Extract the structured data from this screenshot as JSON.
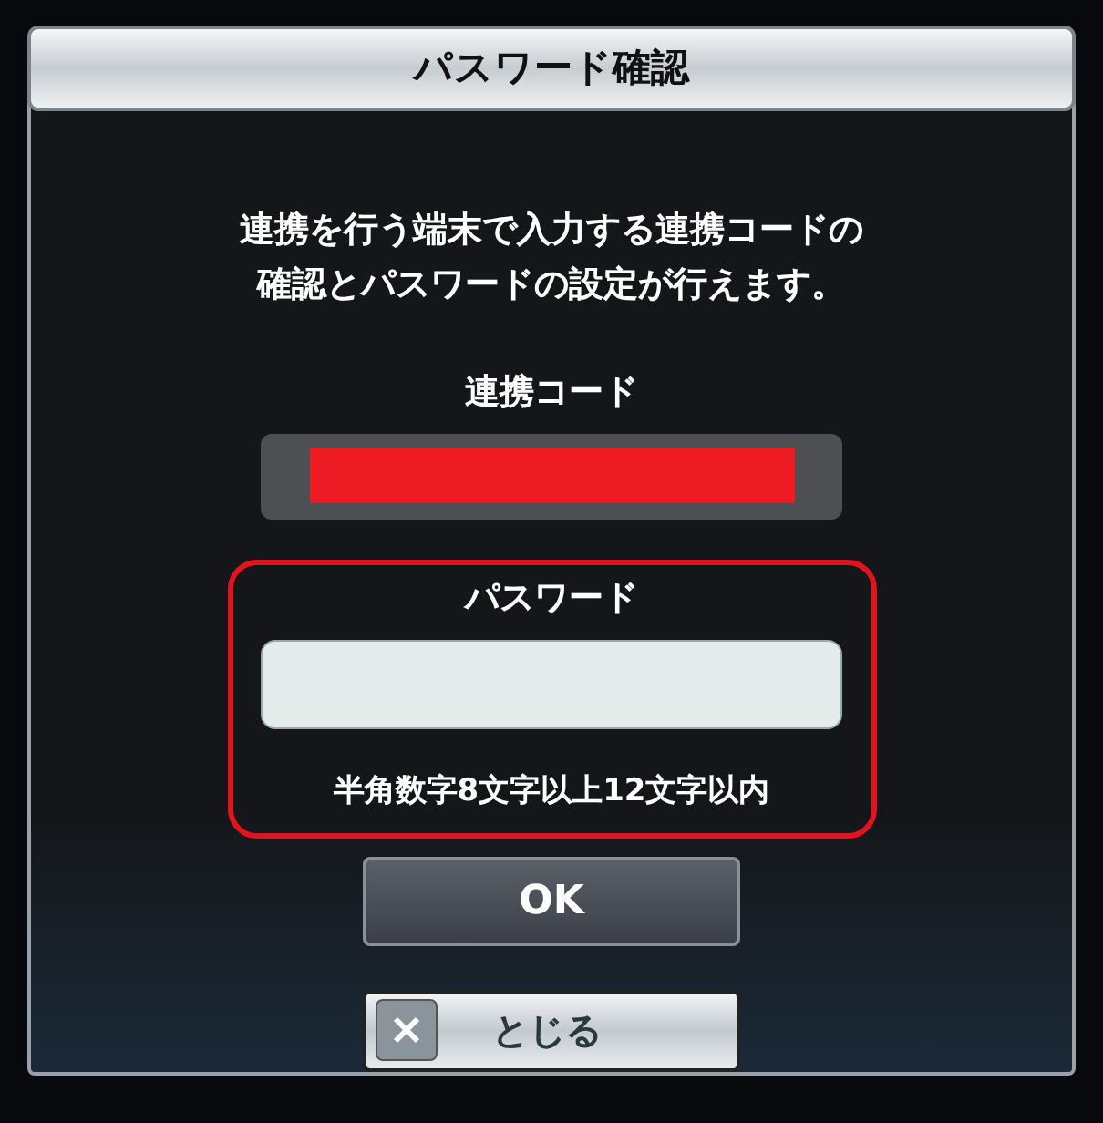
{
  "dialog": {
    "title": "パスワード確認",
    "description": [
      "連携を行う端末で入力する連携コードの",
      "確認とパスワードの設定が行えます。"
    ],
    "code_field": {
      "label": "連携コード",
      "redacted": true
    },
    "password_field": {
      "label": "パスワード",
      "highlighted": true,
      "hint": "半角数字8文字以上12文字以内"
    },
    "ok_button": "OK",
    "close_button": "とじる"
  }
}
